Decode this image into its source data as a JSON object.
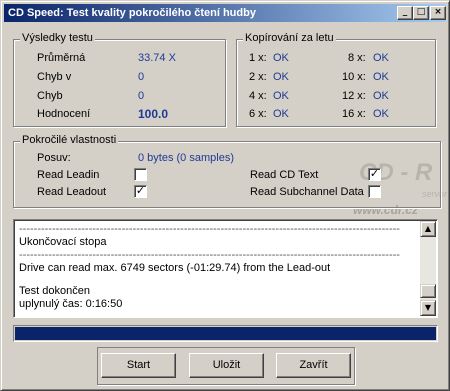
{
  "window": {
    "title": "CD Speed: Test kvality pokročilého čtení hudby",
    "buttons": {
      "minimize": "_",
      "maximize": "□",
      "close": "×"
    }
  },
  "results": {
    "title": "Výsledky testu",
    "rows": [
      {
        "label": "Průměrná",
        "value": "33.74 X"
      },
      {
        "label": "Chyb v",
        "value": "0"
      },
      {
        "label": "Chyb",
        "value": "0"
      },
      {
        "label": "Hodnocení",
        "value": "100.0"
      }
    ]
  },
  "copying": {
    "title": "Kopírování za letu",
    "items": [
      {
        "speed": "1 x:",
        "status": "OK"
      },
      {
        "speed": "8 x:",
        "status": "OK"
      },
      {
        "speed": "2 x:",
        "status": "OK"
      },
      {
        "speed": "10 x:",
        "status": "OK"
      },
      {
        "speed": "4 x:",
        "status": "OK"
      },
      {
        "speed": "12 x:",
        "status": "OK"
      },
      {
        "speed": "6 x:",
        "status": "OK"
      },
      {
        "speed": "16 x:",
        "status": "OK"
      }
    ]
  },
  "advanced": {
    "title": "Pokročilé vlastnosti",
    "offset_label": "Posuv:",
    "offset_value": "0 bytes (0 samples)",
    "options": [
      {
        "label": "Read Leadin",
        "checked": false
      },
      {
        "label": "Read Leadout",
        "checked": true
      },
      {
        "label": "Read CD Text",
        "checked": true
      },
      {
        "label": "Read Subchannel Data",
        "checked": false
      }
    ],
    "check_mark": "✓"
  },
  "watermark": {
    "logo": "CD - R",
    "server_word": "server",
    "url": "www.cdr.cz"
  },
  "log": {
    "lines": [
      "--------------------------------------------------------------------------------------------------------",
      "Ukončovací stopa",
      "--------------------------------------------------------------------------------------------------------",
      "Drive can read max. 6749 sectors (-01:29.74) from the Lead-out",
      "",
      "Test dokončen",
      "uplynulý čas:  0:16:50"
    ]
  },
  "progress": {
    "value": 1.0,
    "color": "#0a246a"
  },
  "actions": {
    "start": "Start",
    "save": "Uložit",
    "close": "Zavřít"
  },
  "colors": {
    "value_text": "#1f3a94",
    "title_start": "#0a246a",
    "title_end": "#a6caf0"
  }
}
